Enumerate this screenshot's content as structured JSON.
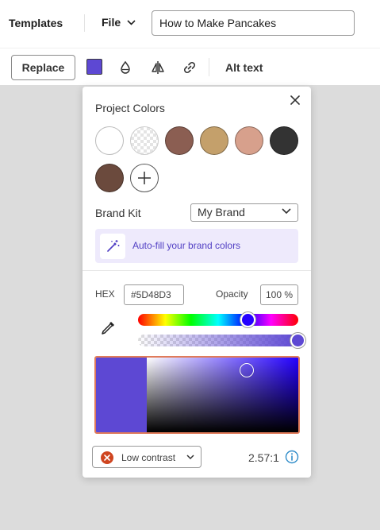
{
  "header": {
    "templates_label": "Templates",
    "file_label": "File",
    "title_value": "How to Make Pancakes"
  },
  "toolbar": {
    "replace_label": "Replace",
    "current_color": "#5D48D3",
    "icons": [
      "transparency-icon",
      "flip-icon",
      "link-icon"
    ],
    "alt_text_label": "Alt text"
  },
  "color_panel": {
    "project_colors_title": "Project Colors",
    "project_colors": [
      "#FFFFFF",
      "transparent",
      "#8B5E52",
      "#C4A06B",
      "#D7A08C",
      "#333333",
      "#6B4A3D"
    ],
    "brand_kit_label": "Brand Kit",
    "brand_kit_value": "My Brand",
    "autofill_label": "Auto-fill your brand colors",
    "hex_label": "HEX",
    "hex_value": "#5D48D3",
    "opacity_label": "Opacity",
    "opacity_value": "100 %",
    "hue_fraction": 0.69,
    "opacity_fraction": 1.0,
    "saturation_fraction": 0.66,
    "brightness_fraction": 0.83,
    "contrast_label": "Low contrast",
    "contrast_ratio": "2.57:1",
    "colors": {
      "accent": "#5D48D3",
      "accent_text": "#5240C4",
      "warning": "#CF4520",
      "picker_border": "#E07B5A",
      "info": "#2F8CC9"
    }
  }
}
